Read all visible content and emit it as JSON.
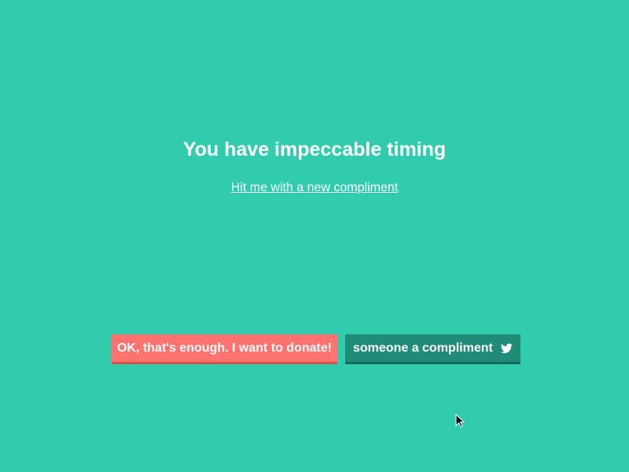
{
  "main": {
    "headline": "You have impeccable timing",
    "new_compliment_link": "Hit me with a new compliment"
  },
  "actions": {
    "donate_label": "OK, that's enough. I want to donate!",
    "tweet_label": "someone a compliment",
    "tweet_icon": "twitter-bird-icon"
  },
  "colors": {
    "background": "#31cbae",
    "donate_button": "#ff736f",
    "tweet_button": "#1f8c78",
    "text": "#ffffff"
  }
}
